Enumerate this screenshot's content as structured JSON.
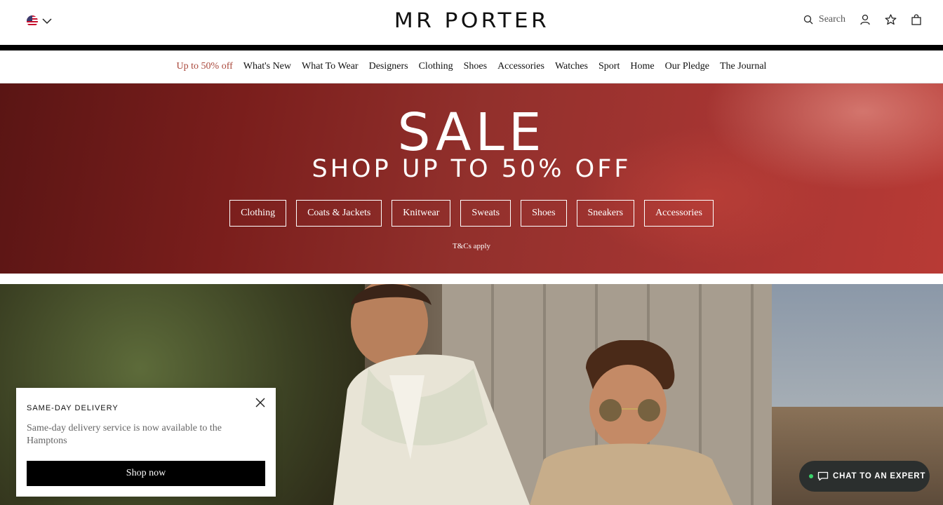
{
  "header": {
    "locale": {
      "flag_icon": "us-flag-icon",
      "chevron_icon": "chevron-down-icon"
    },
    "logo": "MR PORTER",
    "search_label": "Search"
  },
  "nav": {
    "items": [
      {
        "label": "Up to 50% off",
        "highlight_color": "#a9473a"
      },
      {
        "label": "What's New"
      },
      {
        "label": "What To Wear"
      },
      {
        "label": "Designers"
      },
      {
        "label": "Clothing"
      },
      {
        "label": "Shoes"
      },
      {
        "label": "Accessories"
      },
      {
        "label": "Watches"
      },
      {
        "label": "Sport"
      },
      {
        "label": "Home"
      },
      {
        "label": "Our Pledge"
      },
      {
        "label": "The Journal"
      }
    ]
  },
  "banner": {
    "title": "SALE",
    "subtitle": "SHOP UP TO 50% OFF",
    "categories": [
      "Clothing",
      "Coats & Jackets",
      "Knitwear",
      "Sweats",
      "Shoes",
      "Sneakers",
      "Accessories"
    ],
    "terms": "T&Cs apply",
    "background_color": "#8a2a27"
  },
  "popup": {
    "title": "SAME-DAY DELIVERY",
    "text": "Same-day delivery service is now available to the Hamptons",
    "button": "Shop now"
  },
  "chat": {
    "label": "CHAT TO AN EXPERT",
    "status_color": "#3bd36b"
  }
}
